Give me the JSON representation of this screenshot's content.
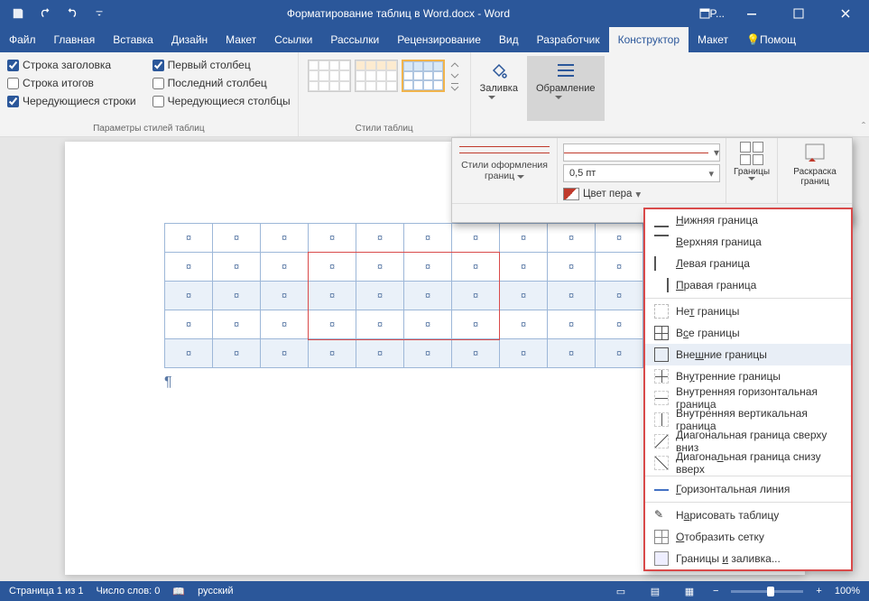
{
  "titlebar": {
    "title": "Форматирование таблиц в Word.docx - Word",
    "share": "P..."
  },
  "tabs": {
    "file": "Файл",
    "home": "Главная",
    "insert": "Вставка",
    "design": "Дизайн",
    "layout": "Макет",
    "refs": "Ссылки",
    "mail": "Рассылки",
    "review": "Рецензирование",
    "view": "Вид",
    "dev": "Разработчик",
    "table_design": "Конструктор",
    "table_layout": "Макет",
    "tell": "Помощ"
  },
  "options": {
    "header_row": "Строка заголовка",
    "total_row": "Строка итогов",
    "banded_rows": "Чередующиеся строки",
    "first_col": "Первый столбец",
    "last_col": "Последний столбец",
    "banded_cols": "Чередующиеся столбцы",
    "group": "Параметры стилей таблиц"
  },
  "styles_group": "Стили таблиц",
  "shade": "Заливка",
  "oframe": "Обрамление",
  "dd": {
    "styles_label": "Стили оформления границ",
    "pt": "0,5 пт",
    "pen": "Цвет пера",
    "obramlenie": "Обрамление",
    "granicy": "Границы",
    "raskraska": "Раскраска границ"
  },
  "bm": {
    "bottom": "Нижняя граница",
    "top": "Верхняя граница",
    "left": "Левая граница",
    "right": "Правая граница",
    "none": "Нет границы",
    "all": "Все границы",
    "outer": "Внешние границы",
    "inner": "Внутренние границы",
    "innerh": "Внутренняя горизонтальная граница",
    "innerv": "Внутренняя вертикальная граница",
    "diagd": "Диагональная граница сверху вниз",
    "diagu": "Диагональная граница снизу вверх",
    "hline": "Горизонтальная линия",
    "draw": "Нарисовать таблицу",
    "grid": "Отобразить сетку",
    "bs": "Границы и заливка..."
  },
  "status": {
    "page": "Страница 1 из 1",
    "words": "Число слов: 0",
    "lang": "русский",
    "zoom": "100%"
  },
  "cellmark": "¤",
  "para": "¶"
}
